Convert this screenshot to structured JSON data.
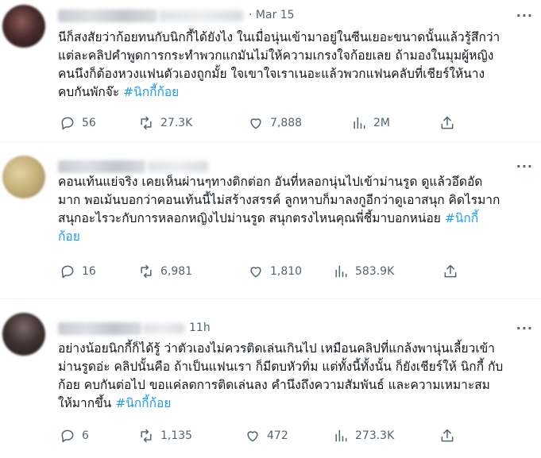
{
  "tweets": [
    {
      "time": "Mar 15",
      "text": "นีก็สงสัยว่าก้อยทนกับนิกกี้ได้ยังไง ในเมื่อนุ่นเข้ามาอยู่ในซีนเยอะขนาดนั้นแล้วรู้สึกว่า\nแต่ละคลิปคำพูดการกระทำพวกแกมันไม่ให้ความเกรงใจก้อยเลย ถ้ามองในมุมผู้หญิง\nคนนึงก็ต้องหวงแฟนตัวเองถูกมั้ย ใจเขาใจเราเนอะแล้วพวกแฟนคลับที่เชียร์ให้นาง\nคบกันพักจ๊ะ ",
      "hashtag": "#นิกกี้ก้อย",
      "replies": "56",
      "reposts": "27.3K",
      "likes": "7,888",
      "views": "2M"
    },
    {
      "time": "",
      "text": "คอนเท้นแย่จริง เคยเห็นผ่านๆทางติกต่อก อันที่หลอกนุ่นไปเข้าม่านรูด ดูแล้วอึดอัด\nมาก พอเม้นบอกว่าคอนเท้นนี้ไม่สร้างสรรค์ ลูกหาบก็มาลงกูอีกว่าดูเอาสนุก คิดไรมาก\nสนุกอะไรวะกับการหลอกหญิงไปม่านรูด สนุกตรงไหนคุณพี่ชี้มาบอกหน่อย ",
      "hashtag": "#นิกกี้\nก้อย",
      "replies": "16",
      "reposts": "6,981",
      "likes": "1,810",
      "views": "583.9K"
    },
    {
      "time": "11h",
      "text": "อย่างน้อยนิกกี้ก็ได้รู้ ว่าตัวเองไม่ควรติดเล่นเกินไป เหมือนคลิปที่แกล้งพานุ่นเลี้ยวเข้า\nม่านรูดอ่ะ คลิปนั้นคือ ถ้าเป็นแฟนเรา ก็มีตบหัวทิ่ม แต่ทั้งนี้ทั้งนั้น ก็ยังเชียร์ให้ นิกกี้ กับ\nก้อย คบกันต่อไป ขอแค่ลดการติดเล่นลง คำนึงถึงความสัมพันธ์ และความเหมาะสม\nให้มากขึ้น ",
      "hashtag": "#นิกกี้ก้อย",
      "replies": "6",
      "reposts": "1,135",
      "likes": "472",
      "views": "273.3K"
    }
  ],
  "icons": {
    "more": "more-icon",
    "reply": "reply-icon",
    "repost": "repost-icon",
    "like": "like-icon",
    "views": "views-icon",
    "share": "share-icon"
  },
  "colors": {
    "hashtag": "#1d9bf0",
    "muted": "#536471",
    "text": "#0f1419"
  }
}
